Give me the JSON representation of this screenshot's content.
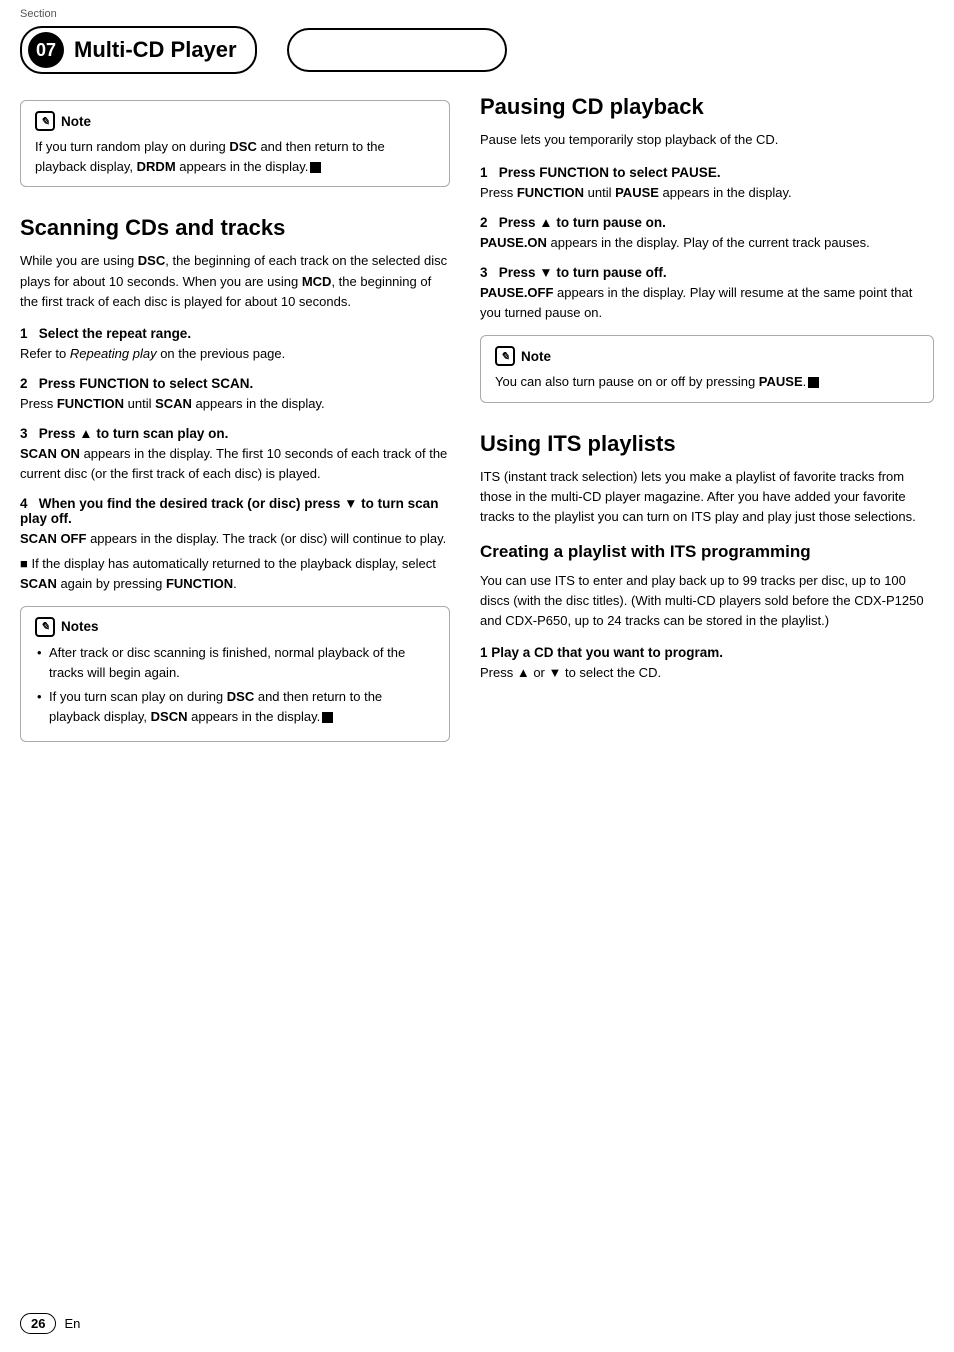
{
  "header": {
    "section_label": "Section",
    "section_number": "07",
    "title": "Multi-CD Player"
  },
  "left": {
    "note1": {
      "label": "Note",
      "text": "If you turn random play on during DSC and then return to the playback display, DRDM appears in the display."
    },
    "scanning": {
      "heading": "Scanning CDs and tracks",
      "intro": "While you are using DSC, the beginning of each track on the selected disc plays for about 10 seconds. When you are using MCD, the beginning of the first track of each disc is played for about 10 seconds.",
      "steps": [
        {
          "num": "1",
          "title": "Select the repeat range.",
          "body": "Refer to Repeating play on the previous page."
        },
        {
          "num": "2",
          "title": "Press FUNCTION to select SCAN.",
          "body": "Press FUNCTION until SCAN appears in the display."
        },
        {
          "num": "3",
          "title": "Press ▲ to turn scan play on.",
          "body": "SCAN ON appears in the display. The first 10 seconds of each track of the current disc (or the first track of each disc) is played."
        },
        {
          "num": "4",
          "title": "When you find the desired track (or disc) press ▼ to turn scan play off.",
          "body_start": "SCAN OFF appears in the display. The track (or disc) will continue to play.",
          "body_extra": "If the display has automatically returned to the playback display, select SCAN again by pressing FUNCTION."
        }
      ],
      "notes_label": "Notes",
      "bullets": [
        "After track or disc scanning is finished, normal playback of the tracks will begin again.",
        "If you turn scan play on during DSC and then return to the playback display, DSCN appears in the display."
      ]
    }
  },
  "right": {
    "pausing": {
      "heading": "Pausing CD playback",
      "intro": "Pause lets you temporarily stop playback of the CD.",
      "steps": [
        {
          "num": "1",
          "title": "Press FUNCTION to select PAUSE.",
          "body": "Press FUNCTION until PAUSE appears in the display."
        },
        {
          "num": "2",
          "title": "Press ▲ to turn pause on.",
          "body": "PAUSE.ON appears in the display. Play of the current track pauses."
        },
        {
          "num": "3",
          "title": "Press ▼ to turn pause off.",
          "body": "PAUSE.OFF appears in the display. Play will resume at the same point that you turned pause on."
        }
      ],
      "note": {
        "label": "Note",
        "text": "You can also turn pause on or off by pressing PAUSE."
      }
    },
    "its": {
      "heading": "Using ITS playlists",
      "intro": "ITS (instant track selection) lets you make a playlist of favorite tracks from those in the multi-CD player magazine. After you have added your favorite tracks to the playlist you can turn on ITS play and play just those selections.",
      "creating": {
        "heading": "Creating a playlist with ITS programming",
        "intro": "You can use ITS to enter and play back up to 99 tracks per disc, up to 100 discs (with the disc titles). (With multi-CD players sold before the CDX-P1250 and CDX-P650, up to 24 tracks can be stored in the playlist.)",
        "step1_title": "1   Play a CD that you want to program.",
        "step1_body": "Press ▲ or ▼ to select the CD."
      }
    }
  },
  "footer": {
    "page": "26",
    "lang": "En"
  }
}
